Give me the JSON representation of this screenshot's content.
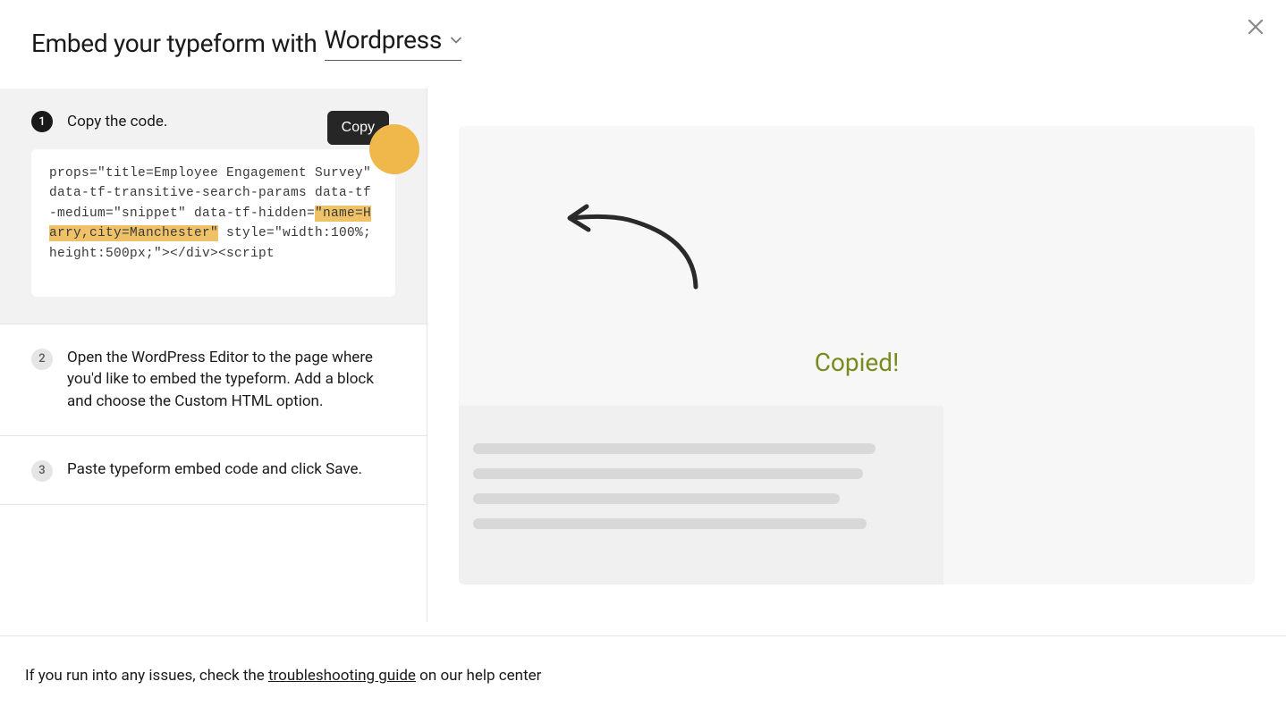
{
  "header": {
    "title_prefix": "Embed your typeform with",
    "platform": "Wordpress"
  },
  "steps": [
    {
      "number": "1",
      "text": "Copy the code.",
      "copy_button": "Copy",
      "code_prefix": "props=\"title=Employee Engagement Survey\" data-tf-transitive-search-params data-tf-medium=\"snippet\" data-tf-hidden=",
      "code_highlighted": "\"name=Harry,city=Manchester\"",
      "code_suffix": " style=\"width:100%;height:500px;\"></div><script"
    },
    {
      "number": "2",
      "text": "Open the WordPress Editor to the page where you'd like to embed the typeform. Add a block and choose the Custom HTML option."
    },
    {
      "number": "3",
      "text": "Paste typeform embed code and click Save."
    }
  ],
  "preview": {
    "copied_label": "Copied!"
  },
  "footer": {
    "text_before": "If you run into any issues, check the ",
    "link_text": "troubleshooting guide",
    "text_after": " on our help center"
  }
}
